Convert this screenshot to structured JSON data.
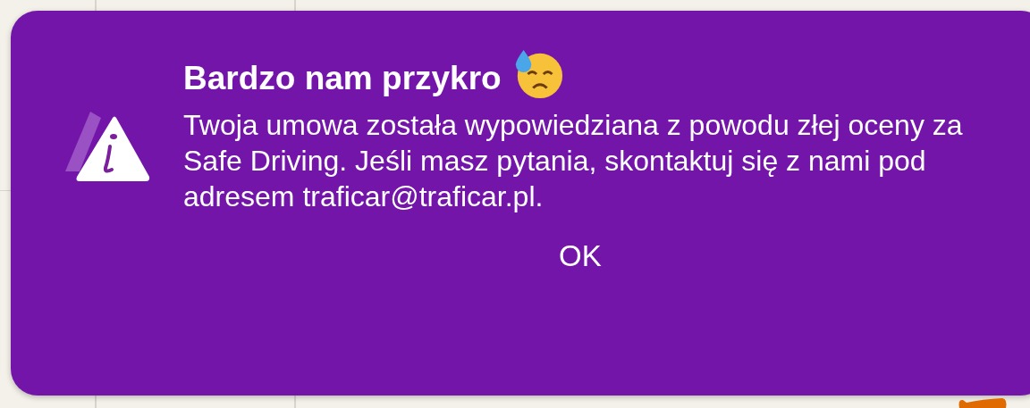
{
  "alert": {
    "title": "Bardzo nam przykro",
    "message": "Twoja umowa została wypowiedziana z powodu złej oceny za Safe Driving. Jeśli masz pytania, skontaktuj się z nami pod adresem traficar@traficar.pl.",
    "button": "OK"
  }
}
